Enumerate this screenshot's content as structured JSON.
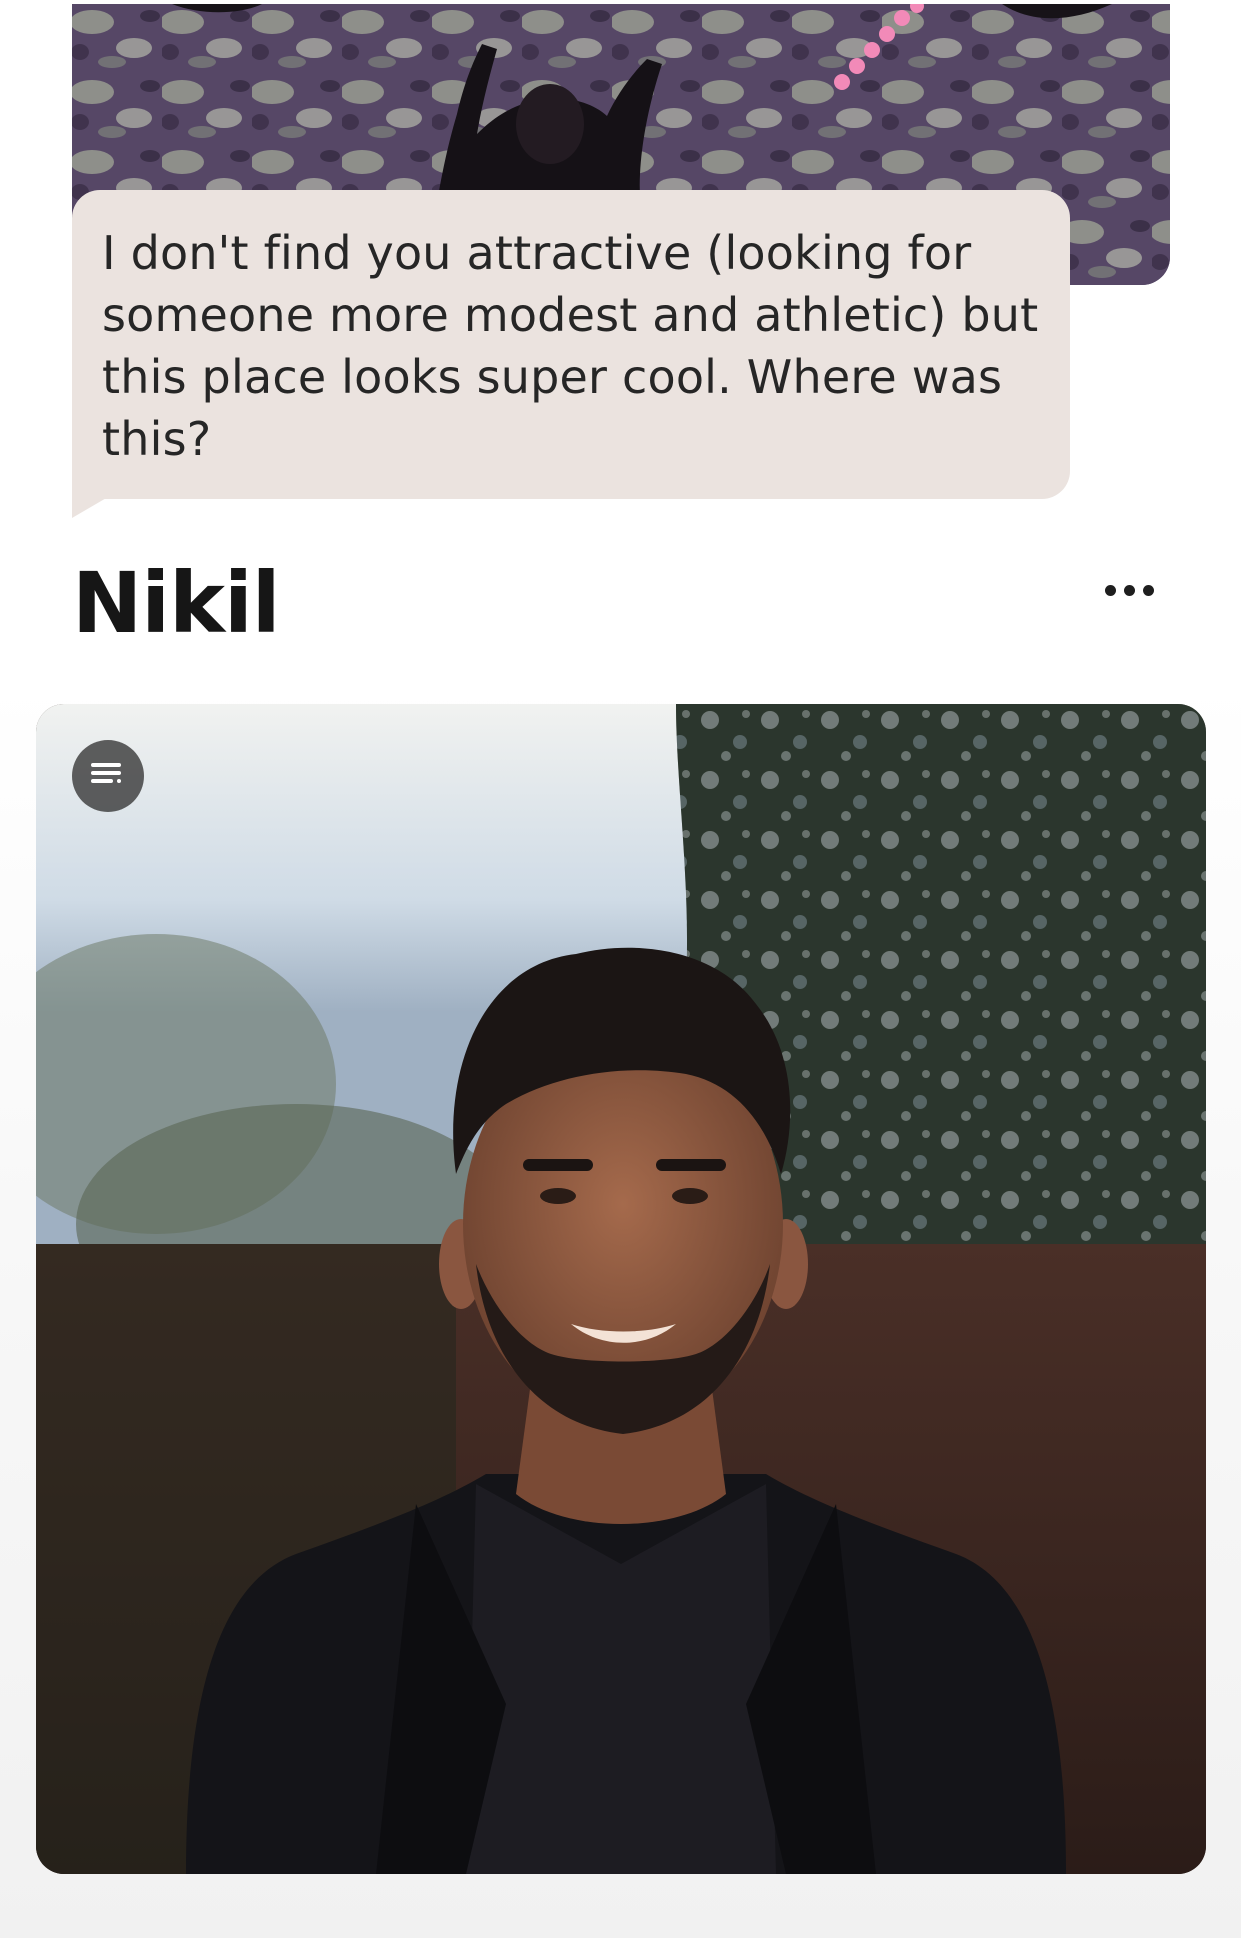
{
  "comment": {
    "text": "I don't find you attractive (looking for someone more modest and athletic) but this place looks super cool. Where was this?"
  },
  "profile": {
    "name": "Nikil"
  },
  "icons": {
    "more": "more-horizontal-icon",
    "prompt": "text-lines-icon"
  },
  "colors": {
    "bubble_background": "#ebe3df",
    "text_primary": "#161616"
  }
}
